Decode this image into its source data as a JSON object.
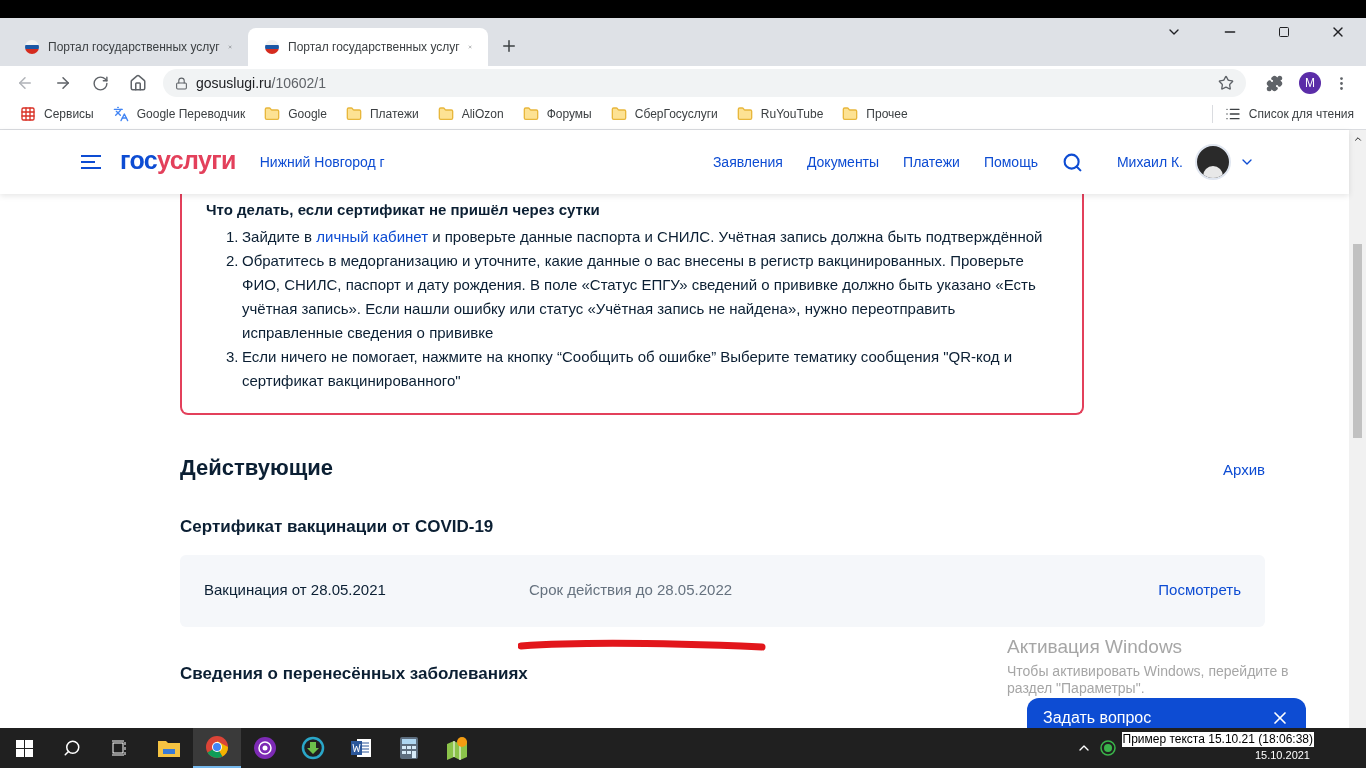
{
  "browser": {
    "tabs": [
      {
        "title": "Портал государственных услуг",
        "selected": false
      },
      {
        "title": "Портал государственных услуг",
        "selected": true
      }
    ],
    "address": {
      "host": "gosuslugi.ru",
      "path": "/10602/1"
    },
    "profile_initial": "M",
    "bookmarks": [
      {
        "label": "Сервисы",
        "kind": "apps"
      },
      {
        "label": "Google Переводчик",
        "kind": "translate"
      },
      {
        "label": "Google",
        "kind": "folder"
      },
      {
        "label": "Платежи",
        "kind": "folder"
      },
      {
        "label": "AliOzon",
        "kind": "folder"
      },
      {
        "label": "Форумы",
        "kind": "folder"
      },
      {
        "label": "СберГосуслуги",
        "kind": "folder"
      },
      {
        "label": "RuYouTube",
        "kind": "folder"
      },
      {
        "label": "Прочее",
        "kind": "folder"
      }
    ],
    "reading_list": "Список для чтения"
  },
  "site_header": {
    "logo_first": "гос",
    "logo_second": "услуги",
    "region": "Нижний Новгород г",
    "nav": [
      "Заявления",
      "Документы",
      "Платежи",
      "Помощь"
    ],
    "user": "Михаил К."
  },
  "notice": {
    "title": "Что делать, если сертификат не пришёл через сутки",
    "steps": [
      {
        "number": "1.",
        "parts": [
          {
            "text": "Зайдите в ",
            "link": false
          },
          {
            "text": "личный кабинет",
            "link": true
          },
          {
            "text": " и проверьте данные паспорта и СНИЛС. Учётная запись должна быть подтверждённой",
            "link": false
          }
        ]
      },
      {
        "number": "2.",
        "parts": [
          {
            "text": "Обратитесь в медорганизацию и уточните, какие данные о вас внесены в регистр вакцинированных. Проверьте ФИО, СНИЛС, паспорт и дату рождения. В поле «Статус ЕПГУ» сведений о прививке должно быть указано «Есть учётная запись». Если нашли ошибку или статус «Учётная запись не найдена», нужно переотправить исправленные сведения о прививке",
            "link": false
          }
        ]
      },
      {
        "number": "3.",
        "parts": [
          {
            "text": "Если ничего не помогает, нажмите на кнопку “Сообщить об ошибке” Выберите тематику сообщения \"QR-код и сертификат вакцинированного\"",
            "link": false
          }
        ]
      }
    ]
  },
  "section": {
    "title": "Действующие",
    "archive_link": "Архив",
    "subtitle": "Сертификат вакцинации от COVID-19",
    "certificate": {
      "vaccination": "Вакцинация от 28.05.2021",
      "validity": "Срок действия до 28.05.2022",
      "action": "Посмотреть"
    },
    "next_title": "Сведения о перенесённых заболеваниях"
  },
  "chat_widget": {
    "label": "Задать вопрос"
  },
  "activation": {
    "title": "Активация Windows",
    "text": "Чтобы активировать Windows, перейдите в раздел \"Параметры\"."
  },
  "taskbar": {
    "apps": [
      {
        "kind": "explorer",
        "selected": false
      },
      {
        "kind": "chrome",
        "selected": true
      },
      {
        "kind": "tor",
        "selected": false
      },
      {
        "kind": "download",
        "selected": false
      },
      {
        "kind": "word",
        "selected": false
      },
      {
        "kind": "calculator",
        "selected": false
      },
      {
        "kind": "maps",
        "selected": false
      }
    ],
    "tooltip": "Пример текста 15.10.21 (18:06:38)",
    "date": "15.10.2021"
  }
}
